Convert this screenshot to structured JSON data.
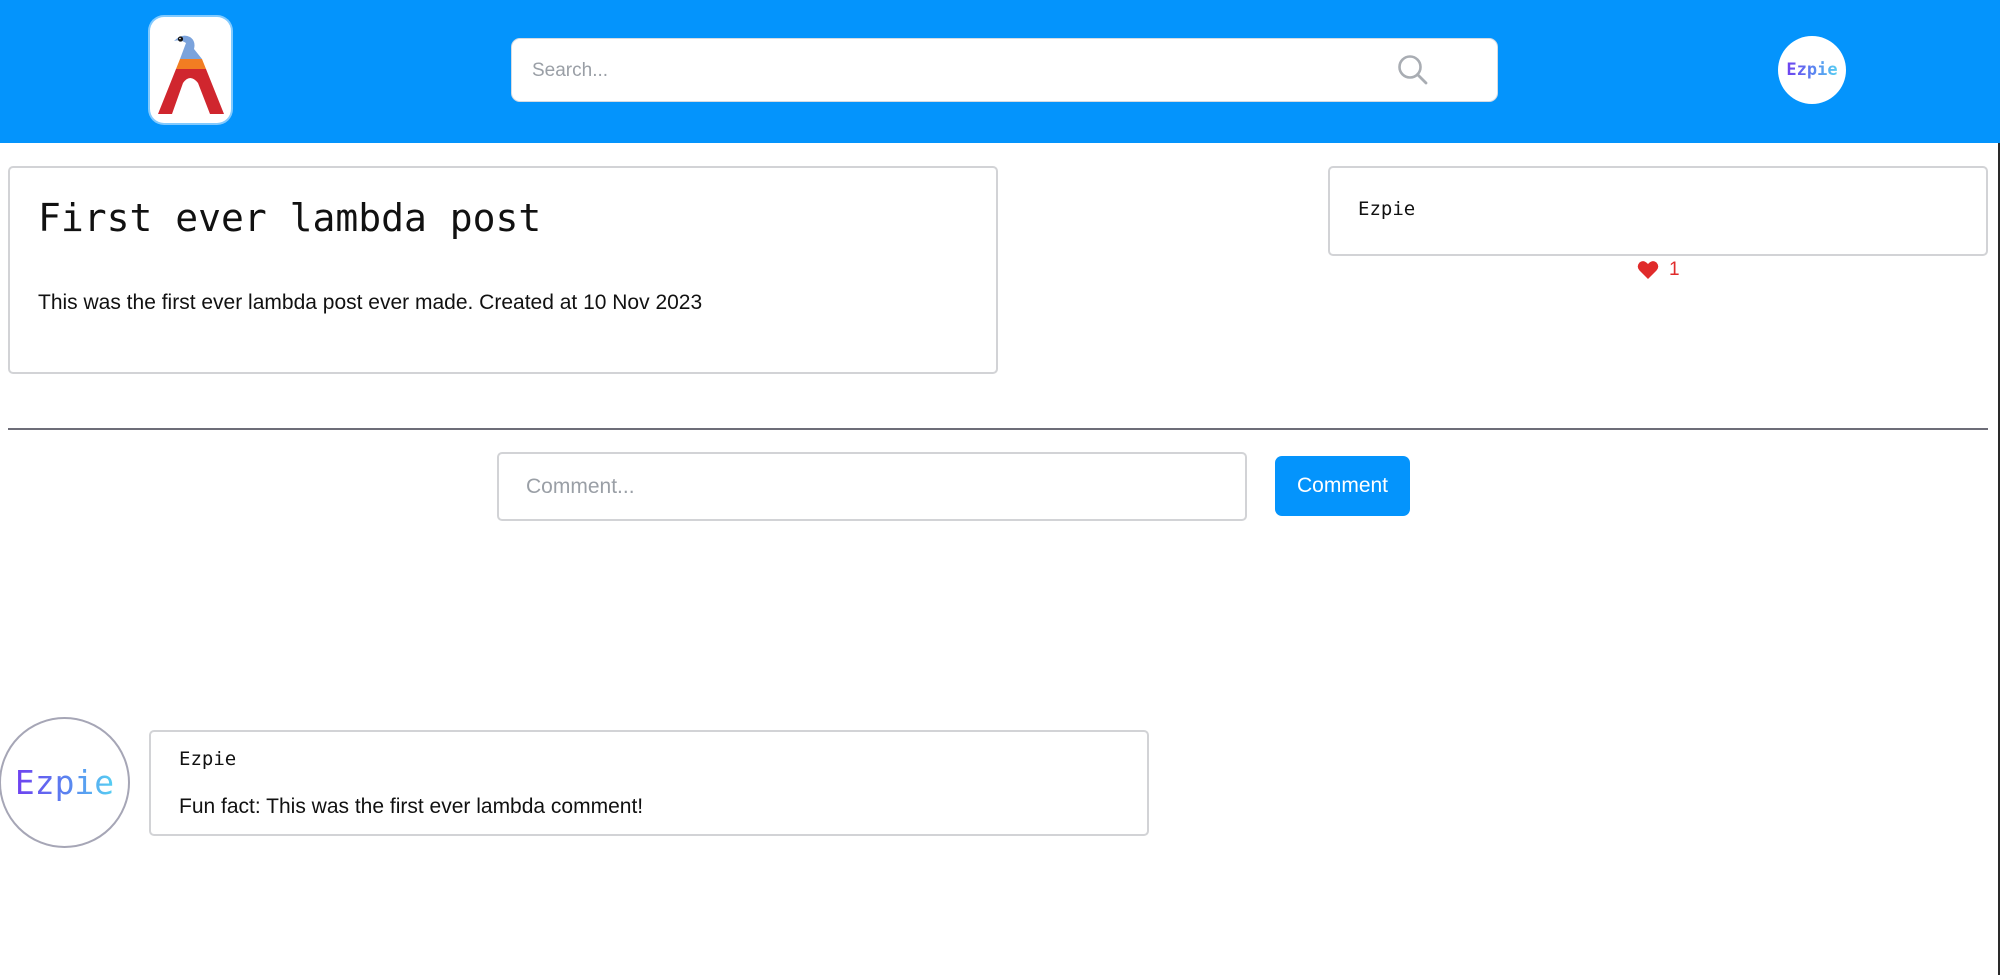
{
  "header": {
    "logo_icon": "lambda-bird-logo-icon",
    "search": {
      "placeholder": "Search...",
      "value": "",
      "icon": "search-icon"
    },
    "user_avatar_text": "Ezpie"
  },
  "post": {
    "title": "First ever lambda post",
    "body": "This was the first ever lambda post ever made. Created at 10 Nov 2023",
    "author": "Ezpie",
    "likes": "1",
    "like_icon": "heart-icon"
  },
  "comment_form": {
    "placeholder": "Comment...",
    "button_label": "Comment"
  },
  "comments": [
    {
      "avatar_text": "Ezpie",
      "author": "Ezpie",
      "text": "Fun fact: This was the first ever lambda comment!"
    }
  ],
  "colors": {
    "brand_blue": "#0494fc",
    "like_red": "#e02b2b",
    "avatar_gradient_start": "#6f3ff0",
    "avatar_gradient_end": "#56d0f2"
  }
}
